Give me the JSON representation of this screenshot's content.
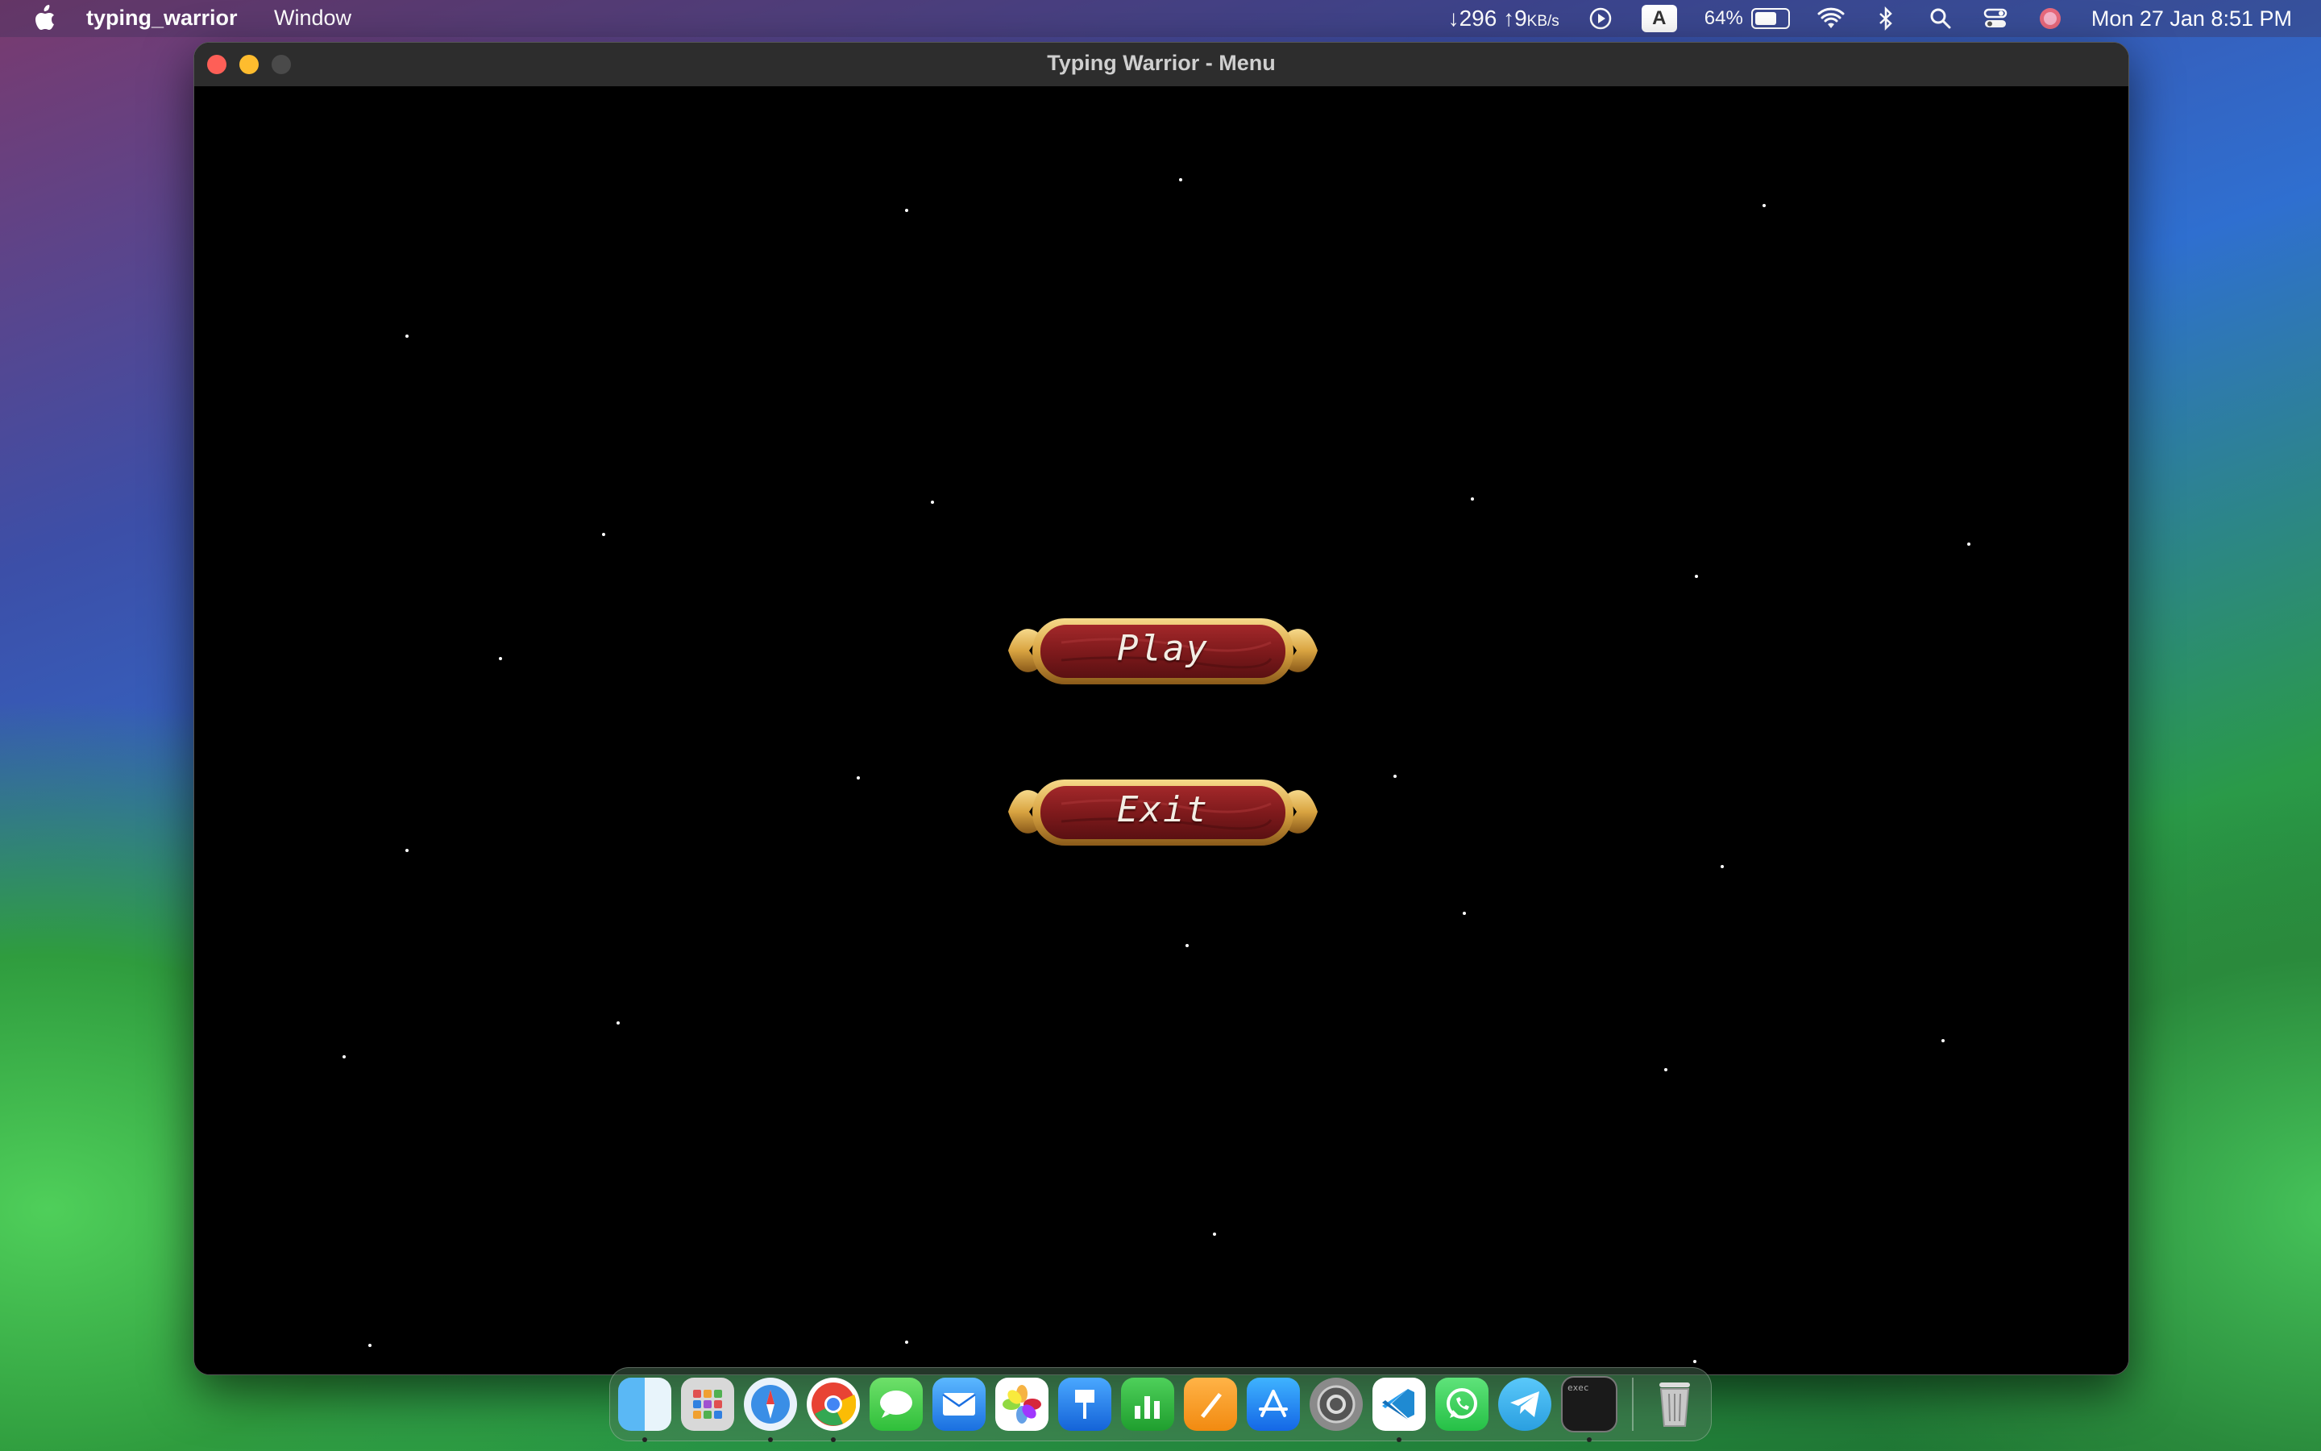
{
  "menubar": {
    "app_name": "typing_warrior",
    "menu_window": "Window",
    "net_speed": "↓296 ↑9",
    "net_unit": "KB/s",
    "keyboard_input": "A",
    "battery": "64%",
    "clock": "Mon 27 Jan  8:51 PM"
  },
  "window": {
    "title": "Typing Warrior - Menu"
  },
  "game": {
    "play_label": "Play",
    "exit_label": "Exit"
  },
  "dock": {
    "apps": [
      "Finder",
      "Launchpad",
      "Safari",
      "Chrome",
      "Messages",
      "Mail",
      "Photos",
      "Keynote",
      "Numbers",
      "Pages",
      "App Store",
      "System Settings",
      "VS Code",
      "WhatsApp",
      "Telegram",
      "Terminal"
    ],
    "terminal_label": "exec",
    "trash": "Trash"
  },
  "colors": {
    "button_red": "#8b1d1d",
    "button_gold": "#d9a441",
    "window_bg": "#000000"
  }
}
